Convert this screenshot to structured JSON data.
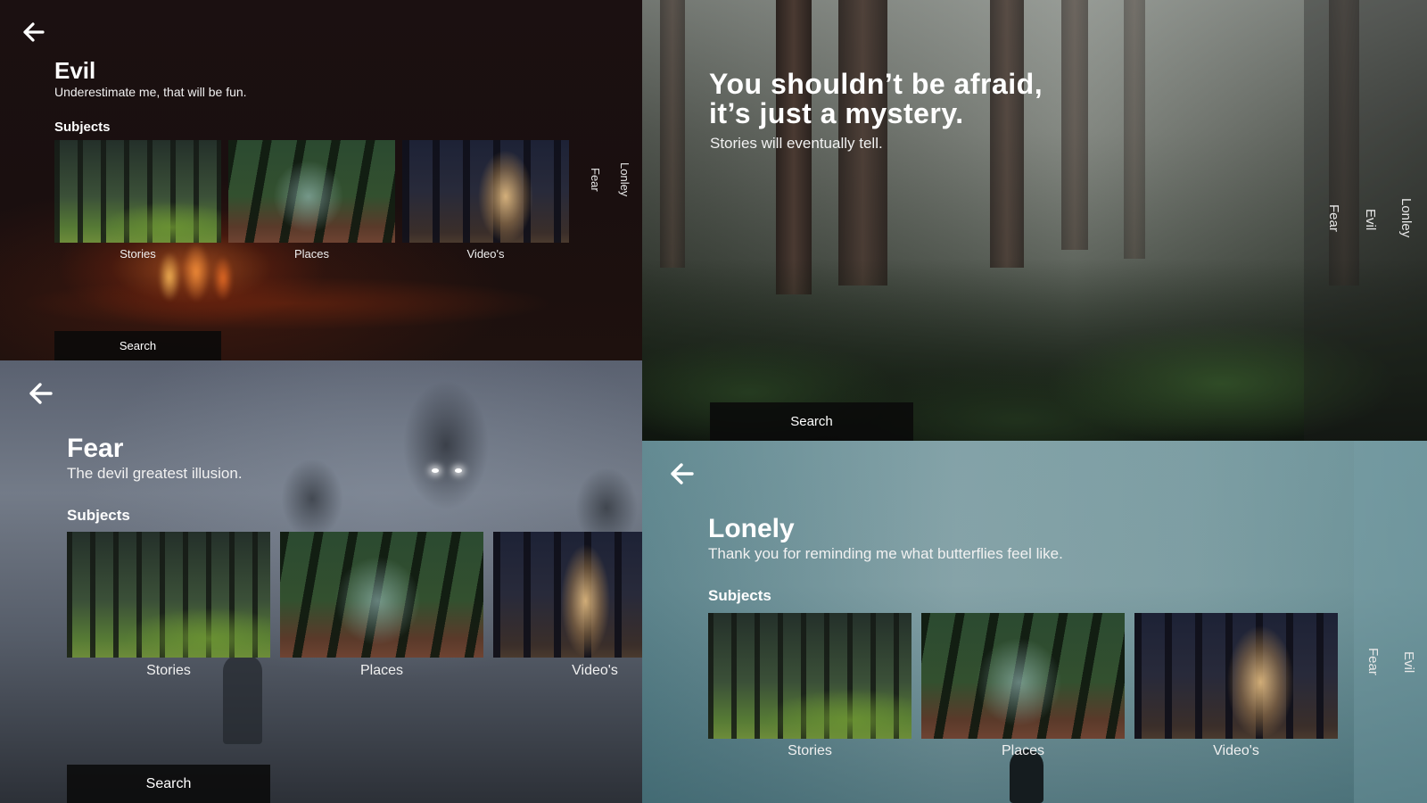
{
  "evil_panel": {
    "title": "Evil",
    "subtitle": "Underestimate me, that will be fun.",
    "subjects_label": "Subjects",
    "thumbnails": [
      {
        "caption": "Stories"
      },
      {
        "caption": "Places"
      },
      {
        "caption": "Video's"
      }
    ],
    "side_tabs": [
      "Fear",
      "Lonley"
    ],
    "search_label": "Search"
  },
  "forest_panel": {
    "headline_line1": "You shouldn’t be afraid,",
    "headline_line2": "it’s just a mystery.",
    "subtitle": "Stories will eventually tell.",
    "side_tabs": [
      "Fear",
      "Evil",
      "Lonley"
    ],
    "search_label": "Search"
  },
  "fear_panel": {
    "title": "Fear",
    "subtitle": "The devil greatest illusion.",
    "subjects_label": "Subjects",
    "thumbnails": [
      {
        "caption": "Stories"
      },
      {
        "caption": "Places"
      },
      {
        "caption": "Video's"
      }
    ],
    "search_label": "Search"
  },
  "lonely_panel": {
    "title": "Lonely",
    "subtitle": "Thank you for reminding me what butterflies feel like.",
    "subjects_label": "Subjects",
    "thumbnails": [
      {
        "caption": "Stories"
      },
      {
        "caption": "Places"
      },
      {
        "caption": "Video's"
      }
    ],
    "side_tabs": [
      "Fear",
      "Evil"
    ]
  },
  "icons": {
    "back": "arrow-left-icon"
  }
}
